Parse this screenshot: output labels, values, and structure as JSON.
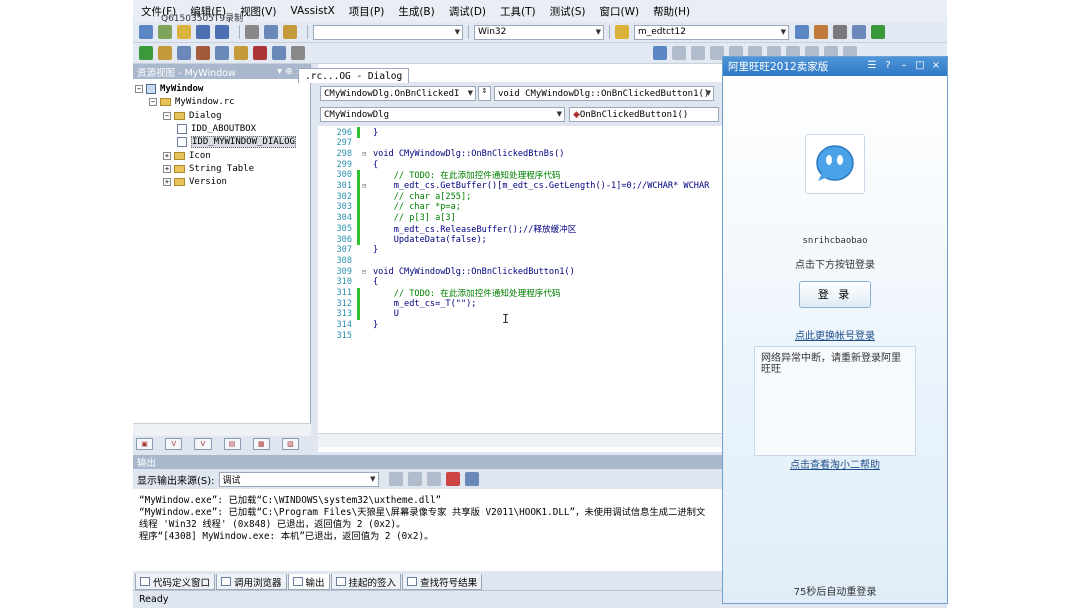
{
  "ide": {
    "recorder_tag": "Q61503505T9录制",
    "menu": [
      "文件(F)",
      "编辑(E)",
      "视图(V)",
      "VAssistX",
      "项目(P)",
      "生成(B)",
      "调试(D)",
      "工具(T)",
      "测试(S)",
      "窗口(W)",
      "帮助(H)"
    ],
    "toolbar": {
      "platform": "Win32",
      "find_value": "m_edtct12",
      "icons": [
        "new-project-icon",
        "add-item-icon",
        "open-icon",
        "save-icon",
        "save-all-icon",
        "cut-icon",
        "copy-icon",
        "paste-icon"
      ]
    },
    "resource_view": {
      "title": "资源视图 - MyWindow",
      "pin": "▾ ⊕ ×",
      "tree": [
        {
          "label": "MyWindow",
          "depth": 0,
          "kind": "project",
          "bold": true
        },
        {
          "label": "MyWindow.rc",
          "depth": 1,
          "kind": "folder"
        },
        {
          "label": "Dialog",
          "depth": 2,
          "kind": "folder"
        },
        {
          "label": "IDD_ABOUTBOX",
          "depth": 3,
          "kind": "doc"
        },
        {
          "label": "IDD_MYWINDOW_DIALOG",
          "depth": 3,
          "kind": "doc"
        },
        {
          "label": "Icon",
          "depth": 2,
          "kind": "folder"
        },
        {
          "label": "String Table",
          "depth": 2,
          "kind": "folder"
        },
        {
          "label": "Version",
          "depth": 2,
          "kind": "folder"
        }
      ],
      "tabs": [
        "V",
        "V"
      ]
    },
    "editor": {
      "tab": ".rc...OG - Dialog",
      "nav_left": "CMyWindowDlg.OnBnClickedI",
      "nav_right": "void CMyWindowDlg::OnBnClickedButton1()",
      "class_combo": "CMyWindowDlg",
      "member_combo": "OnBnClickedButton1()",
      "lines": [
        {
          "n": "296",
          "fold": "",
          "mod": true,
          "style": "normal",
          "text": "}"
        },
        {
          "n": "297",
          "fold": "",
          "mod": false,
          "style": "normal",
          "text": ""
        },
        {
          "n": "298",
          "fold": "⊟",
          "mod": false,
          "style": "normal",
          "text": "void CMyWindowDlg::OnBnClickedBtnBs()"
        },
        {
          "n": "299",
          "fold": "",
          "mod": false,
          "style": "normal",
          "text": "{"
        },
        {
          "n": "300",
          "fold": "",
          "mod": true,
          "style": "comment",
          "text": "    // TODO: 在此添加控件通知处理程序代码"
        },
        {
          "n": "301",
          "fold": "⊟",
          "mod": true,
          "style": "normal",
          "text": "    m_edt_cs.GetBuffer()[m_edt_cs.GetLength()-1]=0;//WCHAR* WCHAR"
        },
        {
          "n": "302",
          "fold": "",
          "mod": true,
          "style": "comment",
          "text": "    // char a[255];"
        },
        {
          "n": "303",
          "fold": "",
          "mod": true,
          "style": "comment",
          "text": "    // char *p=a;"
        },
        {
          "n": "304",
          "fold": "",
          "mod": true,
          "style": "comment",
          "text": "    // p[3] a[3]"
        },
        {
          "n": "305",
          "fold": "",
          "mod": true,
          "style": "normal",
          "text": "    m_edt_cs.ReleaseBuffer();//释放缓冲区"
        },
        {
          "n": "306",
          "fold": "",
          "mod": true,
          "style": "normal",
          "text": "    UpdateData(false);"
        },
        {
          "n": "307",
          "fold": "",
          "mod": false,
          "style": "normal",
          "text": "}"
        },
        {
          "n": "308",
          "fold": "",
          "mod": false,
          "style": "normal",
          "text": ""
        },
        {
          "n": "309",
          "fold": "⊟",
          "mod": false,
          "style": "normal",
          "text": "void CMyWindowDlg::OnBnClickedButton1()"
        },
        {
          "n": "310",
          "fold": "",
          "mod": false,
          "style": "normal",
          "text": "{"
        },
        {
          "n": "311",
          "fold": "",
          "mod": true,
          "style": "comment",
          "text": "    // TODO: 在此添加控件通知处理程序代码"
        },
        {
          "n": "312",
          "fold": "",
          "mod": true,
          "style": "normal",
          "text": "    m_edt_cs=_T(\"\");"
        },
        {
          "n": "313",
          "fold": "",
          "mod": true,
          "style": "normal",
          "text": "    U"
        },
        {
          "n": "314",
          "fold": "",
          "mod": false,
          "style": "normal",
          "text": "}"
        },
        {
          "n": "315",
          "fold": "",
          "mod": false,
          "style": "normal",
          "text": ""
        }
      ]
    },
    "output": {
      "title": "输出",
      "source_label": "显示输出来源(S):",
      "source_value": "调试",
      "lines": [
        "“MyWindow.exe”: 已加载“C:\\WINDOWS\\system32\\uxtheme.dll”",
        "“MyWindow.exe”: 已加载“C:\\Program Files\\天狼星\\屏幕录像专家 共享版 V2011\\HOOK1.DLL”，未使用调试信息生成二进制文",
        "线程 'Win32 线程' (0x848) 已退出，返回值为 2 (0x2)。",
        "程序“[4308] MyWindow.exe: 本机”已退出，返回值为 2 (0x2)。"
      ]
    },
    "bottom_tabs": [
      "代码定义窗口",
      "调用浏览器",
      "输出",
      "挂起的签入",
      "查找符号结果"
    ],
    "status": "Ready"
  },
  "wangwang": {
    "title": "阿里旺旺2012卖家版",
    "username": "snrihcbaobao",
    "hint": "点击下方按钮登录",
    "login_button": "登 录",
    "switch_account": "点此更换帐号登录",
    "message": "网络异常中断，请重新登录阿里旺旺",
    "help_link": "点击查看淘小二帮助",
    "countdown": "75秒后自动重登录"
  }
}
